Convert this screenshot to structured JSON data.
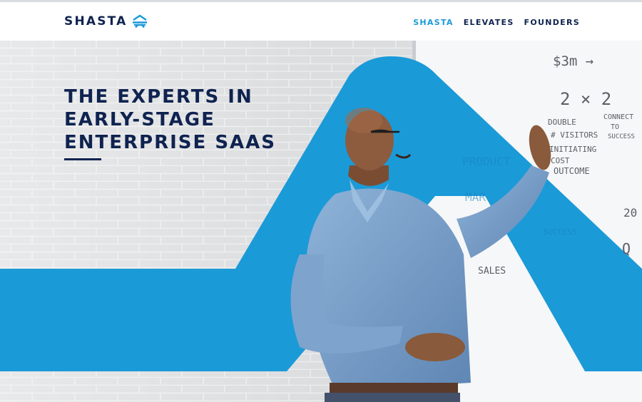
{
  "brand": {
    "name": "SHASTA",
    "logo_icon": "mountain-stripes-icon"
  },
  "nav": {
    "items": [
      {
        "label": "SHASTA",
        "active": true
      },
      {
        "label": "ELEVATES",
        "active": false
      },
      {
        "label": "FOUNDERS",
        "active": false
      }
    ]
  },
  "hero": {
    "headline_lines": [
      "THE EXPERTS IN",
      "EARLY-STAGE",
      "ENTERPRISE SAAS"
    ],
    "image_alt": "Presenter gesturing at a whiteboard",
    "whiteboard_notes": [
      "$3m →",
      "2 × 2",
      "DOUBLE",
      "CONNECT",
      "TO",
      "SUCCESS",
      "# VISITORS",
      "INITIATING",
      "COST",
      "OUTCOME",
      "PRODUCT",
      "MAR",
      "SUCCESS",
      "SALES",
      "20",
      "Q"
    ]
  },
  "colors": {
    "navy": "#0f2350",
    "accent_blue": "#1b9ad8",
    "brick_bg": "#dfe0e1",
    "whiteboard": "#f6f7f8"
  }
}
